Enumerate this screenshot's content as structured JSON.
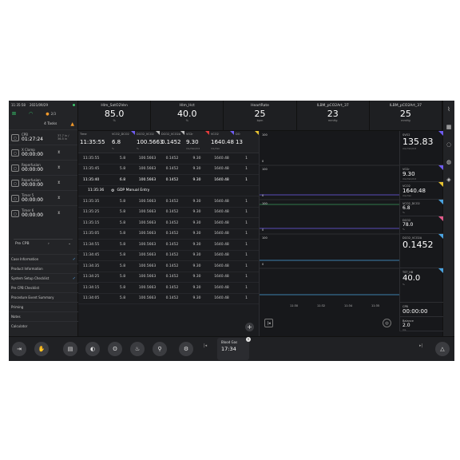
{
  "status": {
    "time": "11:35:58",
    "date": "2021/09/29",
    "pager": "2/3"
  },
  "tasks_label": "4 Tasks",
  "timers": [
    {
      "name": "CPB",
      "value": "01:27:24",
      "right": "37.7 in / 36.5 in"
    },
    {
      "name": "X Clamp",
      "value": "00:00:00",
      "right": ""
    },
    {
      "name": "Reperfusion",
      "value": "00:00:00",
      "right": ""
    },
    {
      "name": "Reperfusion",
      "value": "00:00:00",
      "right": ""
    },
    {
      "name": "Timer 5",
      "value": "00:00:00",
      "right": ""
    },
    {
      "name": "Timer 6",
      "value": "00:00:00",
      "right": ""
    }
  ],
  "phase": {
    "label": "Pre CPB",
    "arrow": "›"
  },
  "checklist": [
    {
      "label": "Case Information",
      "checked": true
    },
    {
      "label": "Product Information",
      "checked": false
    },
    {
      "label": "System Setup Checklist",
      "checked": true
    },
    {
      "label": "Pre CPB Checklist",
      "checked": false
    },
    {
      "label": "Procedure Event Summary",
      "checked": false
    },
    {
      "label": "Priming",
      "checked": false
    },
    {
      "label": "Notes",
      "checked": false
    },
    {
      "label": "Calculator",
      "checked": false
    }
  ],
  "header": [
    {
      "label": "Hlm_SatO2Ven",
      "value": "85.0",
      "unit": "%"
    },
    {
      "label": "Hlm_Hct",
      "value": "40.0",
      "unit": "%"
    },
    {
      "label": "HeartRate",
      "value": "25",
      "unit": "bpm"
    },
    {
      "label": "ILBM_pCO2Art_37",
      "value": "23",
      "unit": "mmHg"
    },
    {
      "label": "ILBM_pCO2Art_37",
      "value": "25",
      "unit": "mmHg"
    }
  ],
  "table": {
    "columns": [
      {
        "label": "Time",
        "value": "11:35:55",
        "unit": ""
      },
      {
        "label": "VCO2_DCO2",
        "value": "6.8",
        "unit": "%"
      },
      {
        "label": "DCO2_VCO2",
        "value": "100.5663",
        "unit": "%"
      },
      {
        "label": "DCO2_VCO2A",
        "value": "0.1452",
        "unit": ""
      },
      {
        "label": "VO2r",
        "value": "9.30",
        "unit": "mL/min/m2"
      },
      {
        "label": "VCO2",
        "value": "1640.48",
        "unit": "mL/min"
      },
      {
        "label": "DO",
        "value": "13",
        "unit": ""
      }
    ],
    "rows": [
      [
        "11:35:55",
        "5.8",
        "100.5663",
        "0.1452",
        "9.30",
        "1640.48",
        "1"
      ],
      [
        "11:35:45",
        "5.8",
        "100.5663",
        "0.1452",
        "9.30",
        "1640.48",
        "1"
      ],
      [
        "11:35:40",
        "6.8",
        "100.5663",
        "0.1452",
        "9.30",
        "1640.48",
        "1"
      ]
    ],
    "entry_label": "GDP Manual Entry",
    "entry_time": "11:35:36",
    "rows2": [
      [
        "11:35:35",
        "5.8",
        "100.5663",
        "0.1452",
        "9.30",
        "1640.48",
        "1"
      ],
      [
        "11:35:25",
        "5.8",
        "100.5663",
        "0.1452",
        "9.30",
        "1640.48",
        "1"
      ],
      [
        "11:35:15",
        "5.8",
        "100.5663",
        "0.1452",
        "9.30",
        "1640.48",
        "1"
      ],
      [
        "11:35:05",
        "5.8",
        "100.5663",
        "0.1452",
        "9.30",
        "1640.48",
        "1"
      ],
      [
        "11:34:55",
        "5.8",
        "100.5663",
        "0.1452",
        "9.30",
        "1640.48",
        "1"
      ],
      [
        "11:34:45",
        "5.8",
        "100.5663",
        "0.1452",
        "9.30",
        "1640.48",
        "1"
      ],
      [
        "11:34:35",
        "5.8",
        "100.5663",
        "0.1452",
        "9.30",
        "1640.48",
        "1"
      ],
      [
        "11:34:25",
        "5.8",
        "100.5663",
        "0.1452",
        "9.30",
        "1640.48",
        "1"
      ],
      [
        "11:34:15",
        "5.8",
        "100.5663",
        "0.1452",
        "9.30",
        "1640.48",
        "1"
      ],
      [
        "11:34:05",
        "5.8",
        "100.5663",
        "0.1452",
        "9.30",
        "1640.48",
        "1"
      ]
    ],
    "add_label": "+"
  },
  "trends": {
    "labels": [
      "100",
      "0",
      "100",
      "0",
      "100",
      "0",
      "100",
      "0"
    ],
    "values": [
      {
        "name": "SVO2",
        "value": "135.83",
        "unit": "mL/min/m2",
        "color": "#6f5cf0"
      },
      {
        "name": "VO2r",
        "value": "9.30",
        "unit": "mL/min/m2",
        "color": "#6f5cf0"
      },
      {
        "name": "VCO2",
        "value": "1640.48",
        "unit": "mL/min",
        "color": "#e6c130"
      },
      {
        "name": "VCO2_DCO2",
        "value": "6.8",
        "unit": "%",
        "color": "#4aa3e0"
      },
      {
        "name": "DCO2",
        "value": "78.0",
        "unit": "%",
        "color": "#e25a8a"
      },
      {
        "name": "DCO2_VCO2A",
        "value": "0.1452",
        "unit": "",
        "color": "#4aa3e0"
      },
      {
        "name": "TST_HB",
        "value": "40.0",
        "unit": "%",
        "color": "#4aa3e0"
      },
      {
        "name": "CPB",
        "value": "00:00:00",
        "unit": "",
        "color": ""
      },
      {
        "name": "Balance",
        "value": "2.0",
        "unit": "mL",
        "color": ""
      }
    ],
    "axis": [
      "11:30",
      "11:32",
      "11:34",
      "11:35"
    ]
  },
  "blood_gas": {
    "title": "Blood Gas",
    "time": "17:34",
    "badge": "5"
  }
}
